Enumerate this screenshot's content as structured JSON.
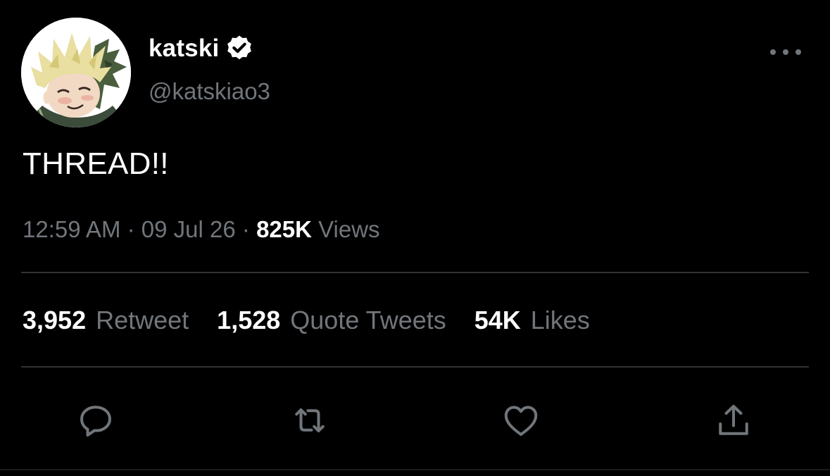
{
  "author": {
    "display_name": "katski",
    "handle": "@katskiao3",
    "verified": true,
    "avatar_icon": "avatar-illustration"
  },
  "tweet": {
    "text": "THREAD!!"
  },
  "meta": {
    "time": "12:59 AM",
    "separator": "·",
    "date": "09 Jul 26",
    "views_count": "825K",
    "views_label": "Views"
  },
  "stats": {
    "retweets_count": "3,952",
    "retweets_label": "Retweet",
    "quotes_count": "1,528",
    "quotes_label": "Quote Tweets",
    "likes_count": "54K",
    "likes_label": "Likes"
  },
  "actions": {
    "reply_icon": "reply-icon",
    "retweet_icon": "retweet-icon",
    "like_icon": "heart-icon",
    "share_icon": "share-icon"
  },
  "colors": {
    "background": "#000000",
    "primary_text": "#ffffff",
    "secondary_text": "#71767b",
    "divider": "#2f3336"
  }
}
